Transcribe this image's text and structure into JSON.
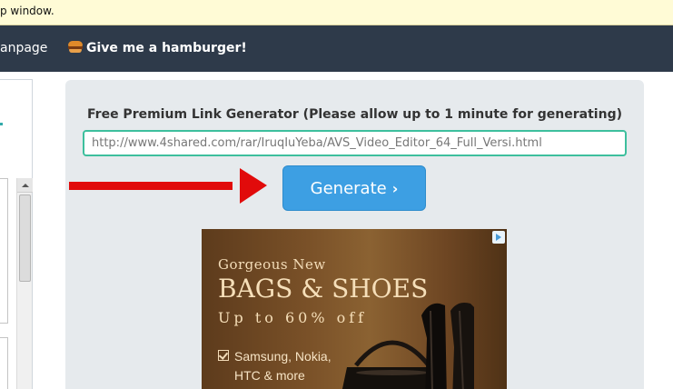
{
  "notice": {
    "text": "p window."
  },
  "nav": {
    "link_mainpage": "anpage",
    "link_hamburger": "Give me a hamburger!",
    "hamburger_icon": "hamburger-icon"
  },
  "generator": {
    "title": "Free Premium Link Generator (Please allow up to 1 minute for generating)",
    "url_value": "http://www.4shared.com/rar/IruqIuYeba/AVS_Video_Editor_64_Full_Versi.html",
    "button_label": "Generate",
    "button_icon": "chevron-right-icon"
  },
  "ad": {
    "line1": "Gorgeous New",
    "line2": "BAGS & SHOES",
    "line3": "Up to 60% off",
    "line4": "Samsung, Nokia,",
    "line5": "HTC & more",
    "adchoices_icon": "adchoices-icon"
  },
  "colors": {
    "navbar": "#2e3a4a",
    "button": "#3d9fe3",
    "input_border": "#3dbf9d",
    "arrow": "#e10b0b",
    "panel": "#e6eaed"
  }
}
